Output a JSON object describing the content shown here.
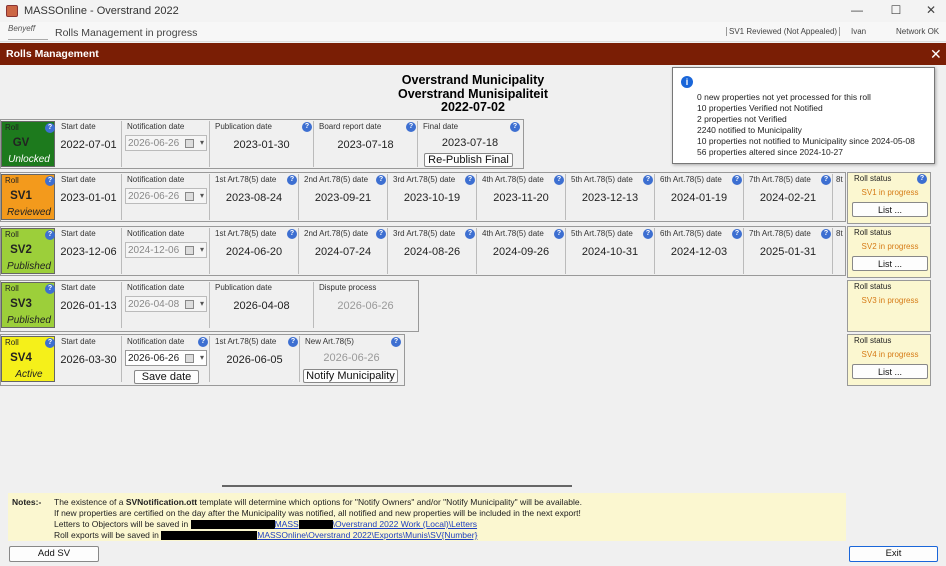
{
  "window": {
    "title": "MASSOnline - Overstrand 2022",
    "min": "—",
    "max": "☐",
    "close": "✕"
  },
  "status_bar": {
    "logo": "Benyeff",
    "progress": "Rolls Management in progress",
    "roll_state": "SV1 Reviewed (Not Appealed)",
    "user": "Ivan",
    "network": "Network OK"
  },
  "dialog": {
    "title": "Rolls Management",
    "close": "✕"
  },
  "heading": {
    "line1": "Overstrand Municipality",
    "line2": "Overstrand Munisipaliteit",
    "date": "2022-07-02"
  },
  "tooltip": {
    "lines": [
      "0 new properties not yet processed for this roll",
      "10 properties Verified not Notified",
      "2 properties not Verified",
      "2240 notified to Municipality",
      "10 properties not notified to Municipality since 2024-05-08",
      "56 properties altered since 2024-10-27"
    ]
  },
  "labels": {
    "roll": "Roll",
    "start_date": "Start date",
    "notification_date": "Notification date",
    "publication_date": "Publication date",
    "board_report_date": "Board report date",
    "final_date": "Final date",
    "art": [
      "1st Art.78(5) date",
      "2nd Art.78(5) date",
      "3rd Art.78(5) date",
      "4th Art.78(5) date",
      "5th Art.78(5) date",
      "6th Art.78(5) date",
      "7th Art.78(5) date",
      "8t"
    ],
    "dispute_process": "Dispute process",
    "new_art": "New Art.78(5)",
    "roll_status": "Roll status",
    "list": "List ...",
    "republish": "Re-Publish Final",
    "save_date": "Save date",
    "notify_municipality": "Notify Municipality"
  },
  "rolls": {
    "gv": {
      "name": "GV",
      "state": "Unlocked",
      "color": "#1d7a1d",
      "start": "2022-07-01",
      "notification": "2026-06-26",
      "publication": "2023-01-30",
      "board_report": "2023-07-18",
      "final": "2023-07-18"
    },
    "sv1": {
      "name": "SV1",
      "state": "Reviewed",
      "color": "#f39a1c",
      "start": "2023-01-01",
      "notification": "2026-06-26",
      "arts": [
        "2023-08-24",
        "2023-09-21",
        "2023-10-19",
        "2023-11-20",
        "2023-12-13",
        "2024-01-19",
        "2024-02-21"
      ],
      "status": "SV1 in progress"
    },
    "sv2": {
      "name": "SV2",
      "state": "Published",
      "color": "#9ccf3a",
      "start": "2023-12-06",
      "notification": "2024-12-06",
      "arts": [
        "2024-06-20",
        "2024-07-24",
        "2024-08-26",
        "2024-09-26",
        "2024-10-31",
        "2024-12-03",
        "2025-01-31"
      ],
      "status": "SV2 in progress"
    },
    "sv3": {
      "name": "SV3",
      "state": "Published",
      "color": "#9ccf3a",
      "start": "2026-01-13",
      "notification": "2026-04-08",
      "publication": "2026-04-08",
      "dispute": "2026-06-26",
      "status": "SV3 in progress"
    },
    "sv4": {
      "name": "SV4",
      "state": "Active",
      "color": "#f5f01a",
      "start": "2026-03-30",
      "notification": "2026-06-26",
      "art1": "2026-06-05",
      "new_art": "2026-06-26",
      "status": "SV4 in progress"
    }
  },
  "notes": {
    "label": "Notes:-",
    "line1_pre": "The existence of a ",
    "line1_bold": "SVNotification.ott",
    "line1_post": " template will determine which options for \"Notify Owners\" and/or \"Notify Municipality\" will be available.",
    "line2": "If new properties are certified on the day after the Municipality was notified, all notified and new properties will be included in the next export!",
    "line3": "Letters to Objectors will be saved in",
    "line3_path1": "MASS",
    "line3_path2": "\\Overstrand 2022 Work (Local)\\Letters",
    "line4": "Roll exports will be saved in",
    "line4_path": "MASSOnline\\Overstrand 2022\\Exports\\Munis\\SV{Number}"
  },
  "buttons": {
    "add_sv": "Add SV",
    "exit": "Exit"
  }
}
